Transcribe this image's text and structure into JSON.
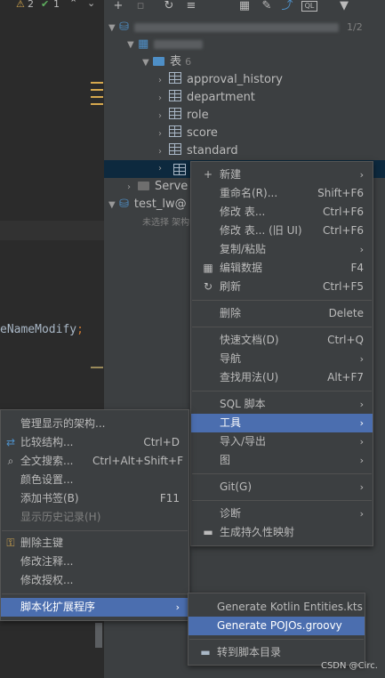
{
  "editor": {
    "warnings_label": "2",
    "checks_label": "1",
    "code_line": "eNameModify",
    "code_semicolon": ";"
  },
  "tree": {
    "connection_1_suffix": "1/2",
    "tables_label": "表",
    "tables_count": "6",
    "tables": [
      "approval_history",
      "department",
      "role",
      "score",
      "standard"
    ],
    "server_objects": "Serve",
    "connection_2_label": "test_lw@",
    "connection_2_hint": "未选择 架构"
  },
  "context_menu": {
    "items": [
      {
        "label": "新建",
        "shortcut": "",
        "submenu": true,
        "icon": "plus-icon"
      },
      {
        "label": "重命名(R)...",
        "shortcut": "Shift+F6"
      },
      {
        "label": "修改 表...",
        "shortcut": "Ctrl+F6"
      },
      {
        "label": "修改 表... (旧 UI)",
        "shortcut": "Ctrl+F6"
      },
      {
        "label": "复制/粘贴",
        "submenu": true
      },
      {
        "label": "编辑数据",
        "shortcut": "F4",
        "icon": "table-icon"
      },
      {
        "label": "刷新",
        "shortcut": "Ctrl+F5",
        "icon": "refresh-icon"
      },
      {
        "label": "删除",
        "shortcut": "Delete"
      },
      {
        "label": "快速文档(D)",
        "shortcut": "Ctrl+Q"
      },
      {
        "label": "导航",
        "submenu": true
      },
      {
        "label": "查找用法(U)",
        "shortcut": "Alt+F7"
      },
      {
        "label": "SQL 脚本",
        "submenu": true
      },
      {
        "label": "工具",
        "submenu": true
      },
      {
        "label": "导入/导出",
        "submenu": true
      },
      {
        "label": "图",
        "submenu": true
      },
      {
        "label": "Git(G)",
        "submenu": true
      },
      {
        "label": "诊断",
        "submenu": true
      },
      {
        "label": "生成持久性映射",
        "icon": "folder-icon"
      }
    ]
  },
  "tools_menu": {
    "items": [
      {
        "label": "管理显示的架构..."
      },
      {
        "label": "比较结构...",
        "shortcut": "Ctrl+D",
        "icon": "compare-icon"
      },
      {
        "label": "全文搜索...",
        "shortcut": "Ctrl+Alt+Shift+F",
        "icon": "search-icon"
      },
      {
        "label": "颜色设置..."
      },
      {
        "label": "添加书签(B)",
        "shortcut": "F11"
      },
      {
        "label": "显示历史记录(H)",
        "disabled": true
      },
      {
        "label": "删除主键",
        "icon": "key-icon"
      },
      {
        "label": "修改注释..."
      },
      {
        "label": "修改授权..."
      },
      {
        "label": "脚本化扩展程序",
        "submenu": true
      }
    ]
  },
  "scripts_menu": {
    "items": [
      {
        "label": "Generate Kotlin Entities.kts"
      },
      {
        "label": "Generate POJOs.groovy"
      },
      {
        "label": "转到脚本目录",
        "icon": "folder-icon"
      }
    ]
  },
  "watermark": "CSDN @Circ.",
  "colors": {
    "highlight": "#4b6eaf",
    "panel": "#3c3f41",
    "editor": "#2b2b2b"
  }
}
